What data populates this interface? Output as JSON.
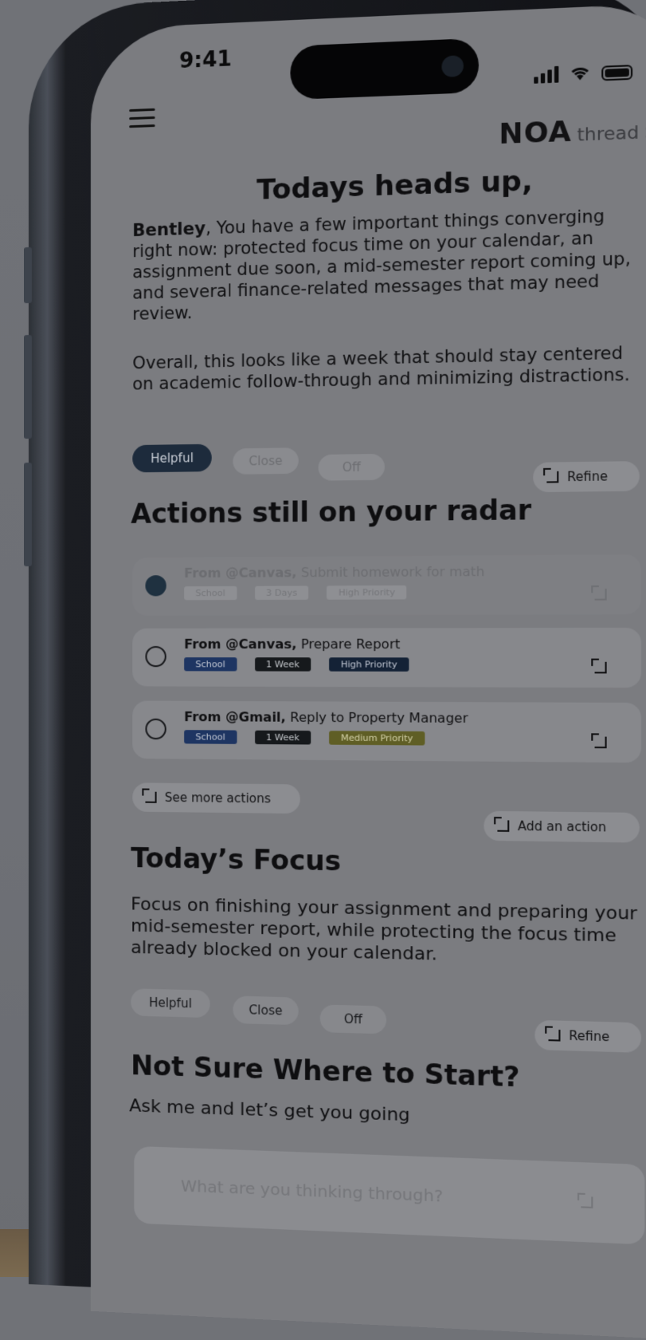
{
  "status": {
    "time": "9:41"
  },
  "brand": {
    "logo": "NOA",
    "sub": "thread",
    "chevron": ">"
  },
  "headsup": {
    "title": "Todays heads up,",
    "name": "Bentley",
    "body1": ", You have a few important things converging right now: protected focus time on your calendar, an assignment due soon, a mid-semester report coming up, and several finance-related messages that may need review.",
    "body2": "Overall, this looks like a week that should stay centered on academic follow-through and minimizing distractions.",
    "feedback": {
      "helpful": "Helpful",
      "close": "Close",
      "off": "Off",
      "refine": "Refine"
    }
  },
  "actions": {
    "title": "Actions still on your radar",
    "items": [
      {
        "source": "From @Canvas,",
        "task": " Submit homework for math",
        "tags": [
          "School",
          "3 Days",
          "High Priority"
        ],
        "done": true
      },
      {
        "source": "From @Canvas,",
        "task": " Prepare Report",
        "tags": [
          "School",
          "1 Week",
          "High Priority"
        ],
        "done": false
      },
      {
        "source": "From @Gmail,",
        "task": " Reply to Property Manager",
        "tags": [
          "School",
          "1 Week",
          "Medium Priority"
        ],
        "done": false
      }
    ],
    "see_more": "See more actions",
    "add": "Add an action"
  },
  "focus": {
    "title": "Today’s Focus",
    "body": "Focus on finishing your assignment and preparing your mid-semester report, while protecting the focus time already blocked on your calendar.",
    "feedback": {
      "helpful": "Helpful",
      "close": "Close",
      "off": "Off",
      "refine": "Refine"
    }
  },
  "start": {
    "title": "Not Sure Where to Start?",
    "subtitle": "Ask me and let’s get you going",
    "placeholder": "What are you thinking through?"
  }
}
